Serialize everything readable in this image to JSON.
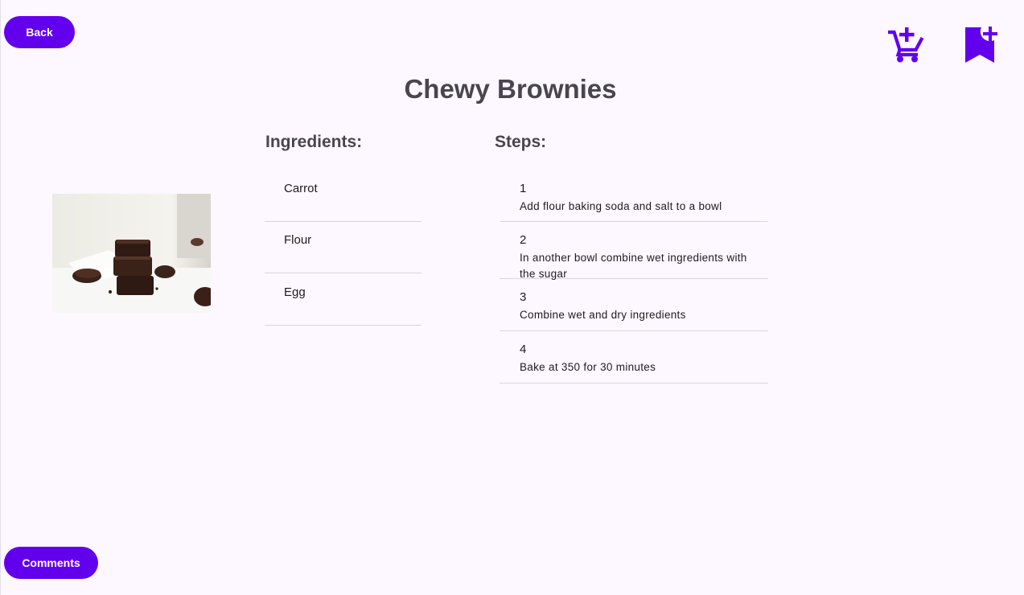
{
  "header": {
    "back_label": "Back"
  },
  "recipe": {
    "title": "Chewy Brownies",
    "ingredients_heading": "Ingredients:",
    "steps_heading": "Steps:",
    "ingredients": [
      "Carrot",
      "Flour",
      "Egg"
    ],
    "steps": [
      {
        "number": "1",
        "text": "Add flour baking soda and salt to a bowl"
      },
      {
        "number": "2",
        "text": "In another bowl combine wet ingredients with the sugar"
      },
      {
        "number": "3",
        "text": "Combine wet and dry ingredients"
      },
      {
        "number": "4",
        "text": "Bake at 350 for 30 minutes"
      }
    ]
  },
  "footer": {
    "comments_label": "Comments"
  },
  "icons": {
    "cart": "add-shopping-cart-icon",
    "bookmark": "bookmark-add-icon"
  },
  "colors": {
    "accent": "#6200ee",
    "background": "#fdf7ff",
    "heading": "#49454f"
  }
}
